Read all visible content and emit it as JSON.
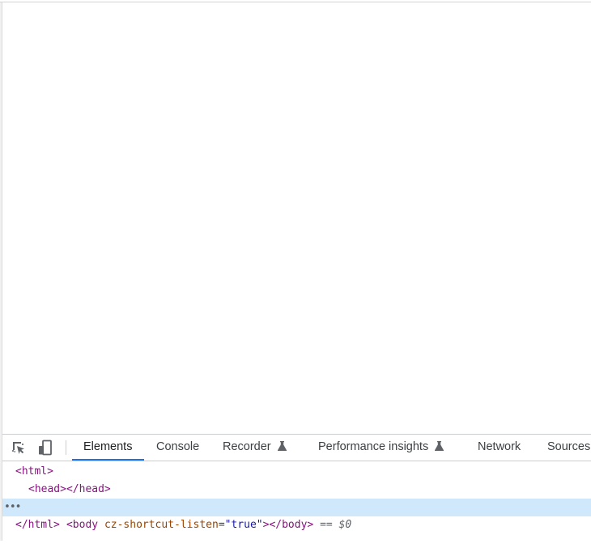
{
  "devtools": {
    "toolbar": {
      "inspect_icon": "inspect-element-icon",
      "device_icon": "device-toolbar-icon"
    },
    "tabs": [
      {
        "label": "Elements",
        "active": true
      },
      {
        "label": "Console"
      },
      {
        "label": "Recorder",
        "experimental": true
      },
      {
        "label": "Performance insights",
        "experimental": true
      },
      {
        "label": "Network"
      },
      {
        "label": "Sources"
      }
    ],
    "dom": {
      "html_open": "<html>",
      "head": "<head></head>",
      "body_open_tag": "<body",
      "body_attr_name": "cz-shortcut-listen",
      "body_attr_eq": "=",
      "body_attr_value": "\"true\"",
      "body_close": "></body>",
      "selected_marker": "== $0",
      "row_dots": "•••",
      "html_close": "</html>"
    },
    "colors": {
      "accent": "#1a73e8",
      "selection": "#cfe8fc",
      "tag": "#881280",
      "attr_name": "#994500",
      "attr_value": "#1a1aa6"
    }
  }
}
